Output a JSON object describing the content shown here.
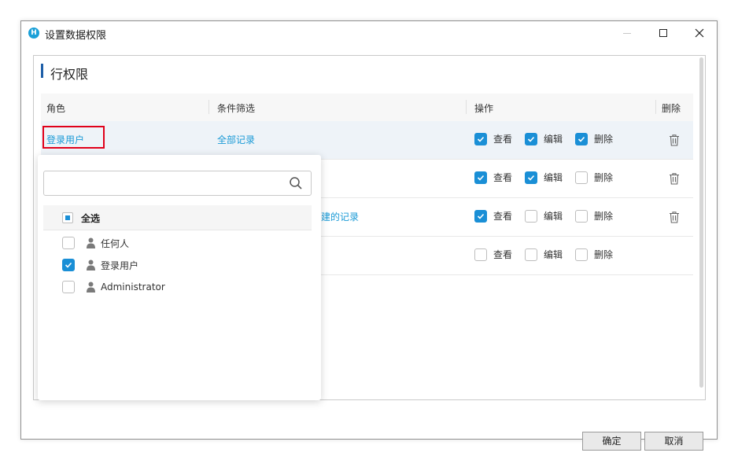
{
  "window": {
    "title": "设置数据权限",
    "app_icon": "H"
  },
  "section": {
    "title": "行权限"
  },
  "table": {
    "headers": {
      "role": "角色",
      "filter": "条件筛选",
      "ops": "操作",
      "delete": "删除"
    },
    "rows": [
      {
        "role": "登录用户",
        "filter": "全部记录",
        "view": true,
        "edit": true,
        "del": true,
        "has_trash": true
      },
      {
        "role": "",
        "filter": "",
        "view": true,
        "edit": true,
        "del": false,
        "has_trash": true
      },
      {
        "role": "",
        "filter": "建的记录",
        "view": true,
        "edit": false,
        "del": false,
        "has_trash": true
      },
      {
        "role": "",
        "filter": "",
        "view": false,
        "edit": false,
        "del": false,
        "has_trash": false
      }
    ],
    "op_labels": {
      "view": "查看",
      "edit": "编辑",
      "del": "删除"
    }
  },
  "popup": {
    "search_placeholder": "",
    "select_all": "全选",
    "items": [
      {
        "label": "任何人",
        "checked": false
      },
      {
        "label": "登录用户",
        "checked": true
      },
      {
        "label": "Administrator",
        "checked": false
      }
    ]
  },
  "footer": {
    "ok": "确定",
    "cancel": "取消"
  },
  "colors": {
    "accent": "#1a8fd6",
    "link": "#1a9ad6",
    "highlight": "#e0001a",
    "section_bar": "#1e5fa8"
  }
}
